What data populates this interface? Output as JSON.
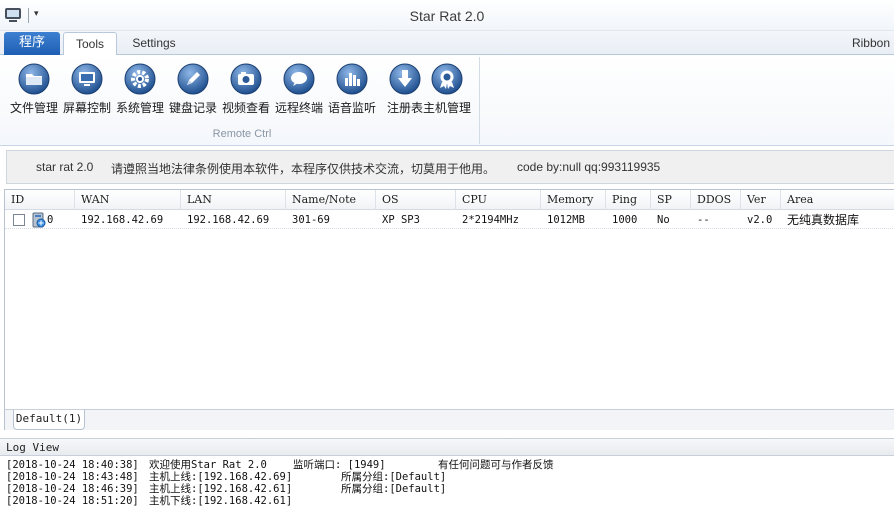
{
  "window": {
    "title": "Star Rat 2.0",
    "qat_glyph": "▾"
  },
  "tabs": {
    "app_menu": "程序",
    "tools": "Tools",
    "settings": "Settings",
    "ribbon_label": "Ribbon"
  },
  "ribbon": {
    "buttons": [
      {
        "label": "文件管理",
        "icon": "folder-icon"
      },
      {
        "label": "屏幕控制",
        "icon": "monitor-icon"
      },
      {
        "label": "系统管理",
        "icon": "gear-icon"
      },
      {
        "label": "键盘记录",
        "icon": "pen-icon"
      },
      {
        "label": "视频查看",
        "icon": "camera-icon"
      },
      {
        "label": "远程终端",
        "icon": "chat-bubble-icon"
      },
      {
        "label": "语音监听",
        "icon": "equalizer-icon"
      },
      {
        "label": "注册表",
        "icon": "download-arrow-icon"
      },
      {
        "label": "主机管理",
        "icon": "badge-icon"
      }
    ],
    "group_caption": "Remote Ctrl"
  },
  "info": {
    "name": "star rat 2.0",
    "notice": "请遵照当地法律条例使用本软件，本程序仅供技术交流，切莫用于他用。",
    "code": "code by:null qq:993119935"
  },
  "hostlist": {
    "columns": [
      "ID",
      "WAN",
      "LAN",
      "Name/Note",
      "OS",
      "CPU",
      "Memory",
      "Ping",
      "SP",
      "DDOS",
      "Ver",
      "Area"
    ],
    "rows": [
      {
        "id": "0",
        "wan": "192.168.42.69",
        "lan": "192.168.42.69",
        "name": "301-69",
        "os": "XP SP3",
        "cpu": "2*2194MHz",
        "memory": "1012MB",
        "ping": "1000",
        "sp": "No",
        "ddos": "--",
        "ver": "v2.0",
        "area": "无纯真数据库",
        "checked": false
      }
    ]
  },
  "groups": {
    "default_tab": "Default(1)"
  },
  "log": {
    "title": "Log View",
    "lines": [
      {
        "time": "[2018-10-24 18:40:38]",
        "msg": "欢迎使用Star Rat 2.0",
        "extra1": "监听端口: [1949]",
        "extra2": "有任何问题可与作者反馈"
      },
      {
        "time": "[2018-10-24 18:43:48]",
        "msg": "主机上线:[192.168.42.69]",
        "extra1": "所属分组:[Default]",
        "extra2": ""
      },
      {
        "time": "[2018-10-24 18:46:39]",
        "msg": "主机上线:[192.168.42.61]",
        "extra1": "所属分组:[Default]",
        "extra2": ""
      },
      {
        "time": "[2018-10-24 18:51:20]",
        "msg": "主机下线:[192.168.42.61]",
        "extra1": "",
        "extra2": ""
      }
    ]
  }
}
